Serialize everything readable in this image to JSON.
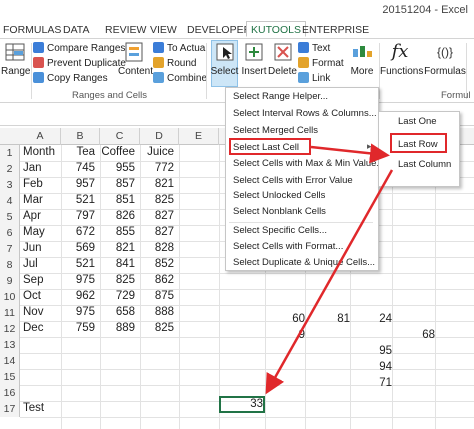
{
  "window": {
    "title": "20151204 - Excel"
  },
  "tabs": [
    "FORMULAS",
    "DATA",
    "REVIEW",
    "VIEW",
    "DEVELOPER",
    "KUTOOLS",
    "ENTERPRISE"
  ],
  "ribbon": {
    "range_label": "Range",
    "compare_ranges": "Compare Ranges",
    "prevent_duplicate": "Prevent Duplicate",
    "copy_ranges": "Copy Ranges",
    "group_ranges_cells": "Ranges and Cells",
    "content_label": "Content",
    "to_actual": "To Actual",
    "round_label": "Round",
    "combine_label": "Combine",
    "select_label": "Select",
    "insert_label": "Insert",
    "delete_label": "Delete",
    "text_label": "Text",
    "format_label": "Format",
    "link_label": "Link",
    "more_label": "More",
    "functions_label": "Functions",
    "formulas_label": "Formulas",
    "fx_symbol": "fx",
    "braces_symbol": "{()}",
    "formula_group_partial": "Formul"
  },
  "columns": [
    "A",
    "B",
    "C",
    "D",
    "E"
  ],
  "rows": [
    {
      "n": "1",
      "a": "Month",
      "b": "Tea",
      "c": "Coffee",
      "d": "Juice"
    },
    {
      "n": "2",
      "a": "Jan",
      "b": "745",
      "c": "955",
      "d": "772"
    },
    {
      "n": "3",
      "a": "Feb",
      "b": "957",
      "c": "857",
      "d": "821"
    },
    {
      "n": "4",
      "a": "Mar",
      "b": "521",
      "c": "851",
      "d": "825"
    },
    {
      "n": "5",
      "a": "Apr",
      "b": "797",
      "c": "826",
      "d": "827"
    },
    {
      "n": "6",
      "a": "May",
      "b": "672",
      "c": "855",
      "d": "827"
    },
    {
      "n": "7",
      "a": "Jun",
      "b": "569",
      "c": "821",
      "d": "828"
    },
    {
      "n": "8",
      "a": "Jul",
      "b": "521",
      "c": "841",
      "d": "852"
    },
    {
      "n": "9",
      "a": "Sep",
      "b": "975",
      "c": "825",
      "d": "862"
    },
    {
      "n": "10",
      "a": "Oct",
      "b": "962",
      "c": "729",
      "d": "875"
    },
    {
      "n": "11",
      "a": "Nov",
      "b": "975",
      "c": "658",
      "d": "888"
    },
    {
      "n": "12",
      "a": "Dec",
      "b": "759",
      "c": "889",
      "d": "825"
    },
    {
      "n": "13",
      "a": "",
      "b": "",
      "c": "",
      "d": ""
    },
    {
      "n": "14",
      "a": "",
      "b": "",
      "c": "",
      "d": ""
    },
    {
      "n": "15",
      "a": "",
      "b": "",
      "c": "",
      "d": ""
    },
    {
      "n": "16",
      "a": "",
      "b": "",
      "c": "",
      "d": ""
    },
    {
      "n": "17",
      "a": "Test",
      "b": "",
      "c": "",
      "d": ""
    }
  ],
  "extra_cells": {
    "r10_f": "60",
    "r10_g": "81",
    "r10_h": "24",
    "r11_f": "9",
    "r11_i": "68",
    "r12_h": "95",
    "r13_h": "94",
    "r14_h": "71",
    "r17_sel": "33"
  },
  "menu": {
    "items": [
      "Select Range Helper...",
      "Select Interval Rows & Columns...",
      "Select Merged Cells",
      "Select Last Cell",
      "Select Cells with Max & Min Value...",
      "Select Cells with Error Value",
      "Select Unlocked Cells",
      "Select Nonblank Cells",
      "Select Specific Cells...",
      "Select Cells with Format...",
      "Select Duplicate & Unique Cells..."
    ],
    "submenu": [
      "Last One",
      "Last Row",
      "Last Column"
    ]
  },
  "colors": {
    "accent": "#217346",
    "highlight": "#e0282b",
    "select_btn": "#cde6f7"
  }
}
